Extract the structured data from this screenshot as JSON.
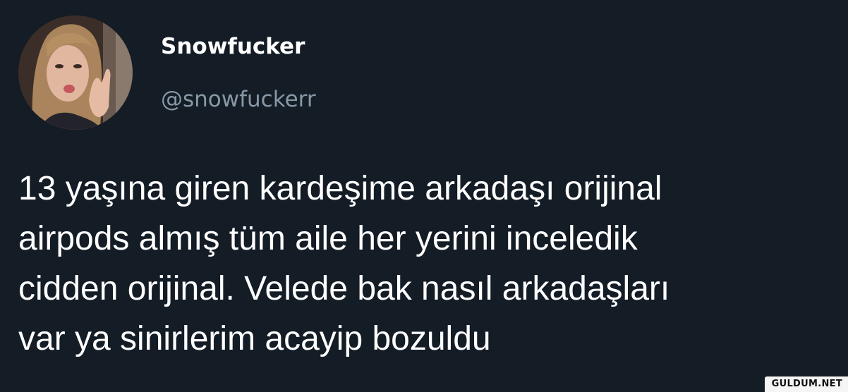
{
  "user": {
    "display_name": "Snowfucker",
    "handle": "@snowfuckerr"
  },
  "tweet": {
    "lines": [
      "13 yaşına giren kardeşime arkadaşı orijinal",
      "airpods almış tüm aile her yerini inceledik",
      "cidden orijinal. Velede bak nasıl arkadaşları",
      "var ya sinirlerim acayip bozuldu"
    ]
  },
  "watermark": {
    "text": "GULDUM.NET"
  },
  "colors": {
    "background": "#141c26",
    "name": "#ffffff",
    "handle": "#8899a6",
    "text": "#ffffff"
  }
}
